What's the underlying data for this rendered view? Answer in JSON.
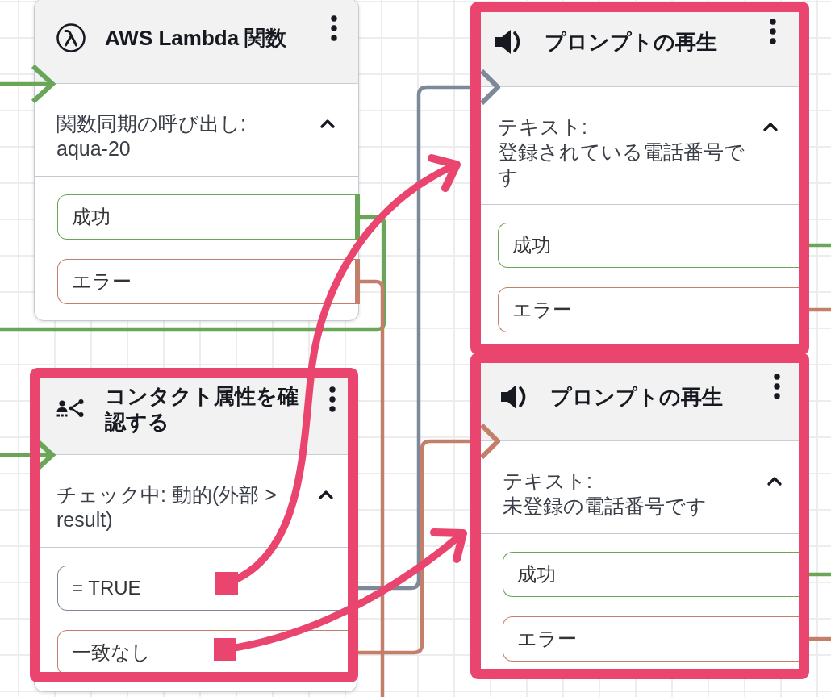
{
  "canvas": {
    "blocks": [
      {
        "kind": "lambda",
        "title": "AWS Lambda 関数",
        "highlighted": false,
        "expanded": true,
        "detail_lines": [
          "関数同期の呼び出し:",
          "aqua-20"
        ],
        "branches": [
          {
            "label": "成功",
            "color": "#6aa657"
          },
          {
            "label": "エラー",
            "color": "#c47f6b"
          }
        ]
      },
      {
        "kind": "play_prompt",
        "title": "プロンプトの再生",
        "highlighted": true,
        "expanded": true,
        "detail_lines": [
          "テキスト:",
          "登録されている電話番号です"
        ],
        "branches": [
          {
            "label": "成功",
            "color": "#6aa657"
          },
          {
            "label": "エラー",
            "color": "#c47f6b"
          }
        ]
      },
      {
        "kind": "check_attributes",
        "title": "コンタクト属性を確認する",
        "highlighted": true,
        "expanded": true,
        "detail_lines": [
          "チェック中: 動的(外部 > result)"
        ],
        "branches": [
          {
            "label": "= TRUE",
            "color": "#7d8998"
          },
          {
            "label": "一致なし",
            "color": "#c47f6b"
          }
        ]
      },
      {
        "kind": "play_prompt",
        "title": "プロンプトの再生",
        "highlighted": true,
        "expanded": true,
        "detail_lines": [
          "テキスト:",
          "未登録の電話番号です"
        ],
        "branches": [
          {
            "label": "成功",
            "color": "#6aa657"
          },
          {
            "label": "エラー",
            "color": "#c47f6b"
          }
        ]
      }
    ]
  }
}
